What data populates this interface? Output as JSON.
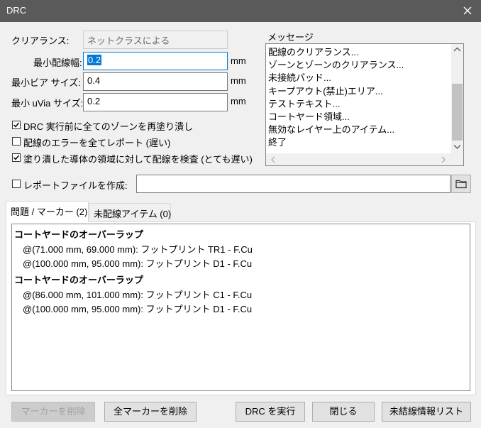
{
  "window": {
    "title": "DRC"
  },
  "clearance": {
    "label": "クリアランス:",
    "value": "ネットクラスによる"
  },
  "min_track": {
    "label": "最小配線幅:",
    "value": "0.2",
    "unit": "mm"
  },
  "min_via": {
    "label": "最小ビア サイズ:",
    "value": "0.4",
    "unit": "mm"
  },
  "min_uvia": {
    "label": "最小 uVia サイズ:",
    "value": "0.2",
    "unit": "mm"
  },
  "options": [
    {
      "label": "DRC 実行前に全てのゾーンを再塗り潰し",
      "checked": true
    },
    {
      "label": "配線のエラーを全てレポート (遅い)",
      "checked": false
    },
    {
      "label": "塗り潰した導体の領域に対して配線を検査 (とても遅い)",
      "checked": true
    }
  ],
  "messages": {
    "title": "メッセージ",
    "items": [
      "配線のクリアランス...",
      "ゾーンとゾーンのクリアランス...",
      "未接続パッド...",
      "キープアウト(禁止)エリア...",
      "テストテキスト...",
      "コートヤード領域...",
      "無効なレイヤー上のアイテム...",
      "終了"
    ]
  },
  "report": {
    "label": "レポートファイルを作成:",
    "checked": false,
    "value": ""
  },
  "tabs": [
    {
      "label": "問題 / マーカー (2)",
      "active": true
    },
    {
      "label": "未配線アイテム (0)",
      "active": false
    }
  ],
  "markers": [
    {
      "title": "コートヤードのオーバーラップ",
      "items": [
        "@(71.000 mm, 69.000 mm): フットプリント TR1 - F.Cu",
        "@(100.000 mm, 95.000 mm): フットプリント D1 - F.Cu"
      ]
    },
    {
      "title": "コートヤードのオーバーラップ",
      "items": [
        "@(86.000 mm, 101.000 mm): フットプリント C1 - F.Cu",
        "@(100.000 mm, 95.000 mm): フットプリント D1 - F.Cu"
      ]
    }
  ],
  "buttons": {
    "delete_marker": "マーカーを削除",
    "delete_all": "全マーカーを削除",
    "run": "DRC を実行",
    "close": "閉じる",
    "unconnected_list": "未結線情報リスト"
  }
}
